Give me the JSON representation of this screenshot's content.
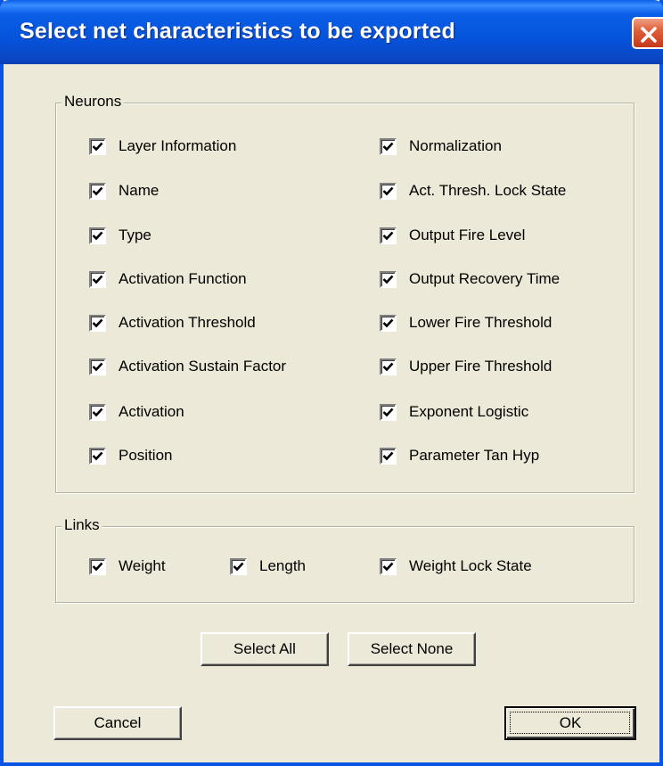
{
  "dialog": {
    "title": "Select net characteristics to be exported"
  },
  "neurons": {
    "label": "Neurons",
    "left": [
      {
        "label": "Layer Information",
        "checked": true
      },
      {
        "label": "Name",
        "checked": true
      },
      {
        "label": "Type",
        "checked": true
      },
      {
        "label": "Activation Function",
        "checked": true
      },
      {
        "label": "Activation Threshold",
        "checked": true
      },
      {
        "label": "Activation Sustain Factor",
        "checked": true
      },
      {
        "label": "Activation",
        "checked": true
      },
      {
        "label": "Position",
        "checked": true
      }
    ],
    "right": [
      {
        "label": "Normalization",
        "checked": true
      },
      {
        "label": "Act. Thresh. Lock State",
        "checked": true
      },
      {
        "label": "Output Fire Level",
        "checked": true
      },
      {
        "label": "Output Recovery Time",
        "checked": true
      },
      {
        "label": "Lower Fire Threshold",
        "checked": true
      },
      {
        "label": "Upper Fire Threshold",
        "checked": true
      },
      {
        "label": "Exponent Logistic",
        "checked": true
      },
      {
        "label": "Parameter Tan Hyp",
        "checked": true
      }
    ]
  },
  "links": {
    "label": "Links",
    "items": [
      {
        "label": "Weight",
        "checked": true
      },
      {
        "label": "Length",
        "checked": true
      },
      {
        "label": "Weight Lock State",
        "checked": true
      }
    ]
  },
  "buttons": {
    "select_all": "Select All",
    "select_none": "Select None",
    "cancel": "Cancel",
    "ok": "OK"
  },
  "colors": {
    "titlebar": "#0a5fe8",
    "dialog_bg": "#ece9d8",
    "close_button": "#e0603a"
  }
}
